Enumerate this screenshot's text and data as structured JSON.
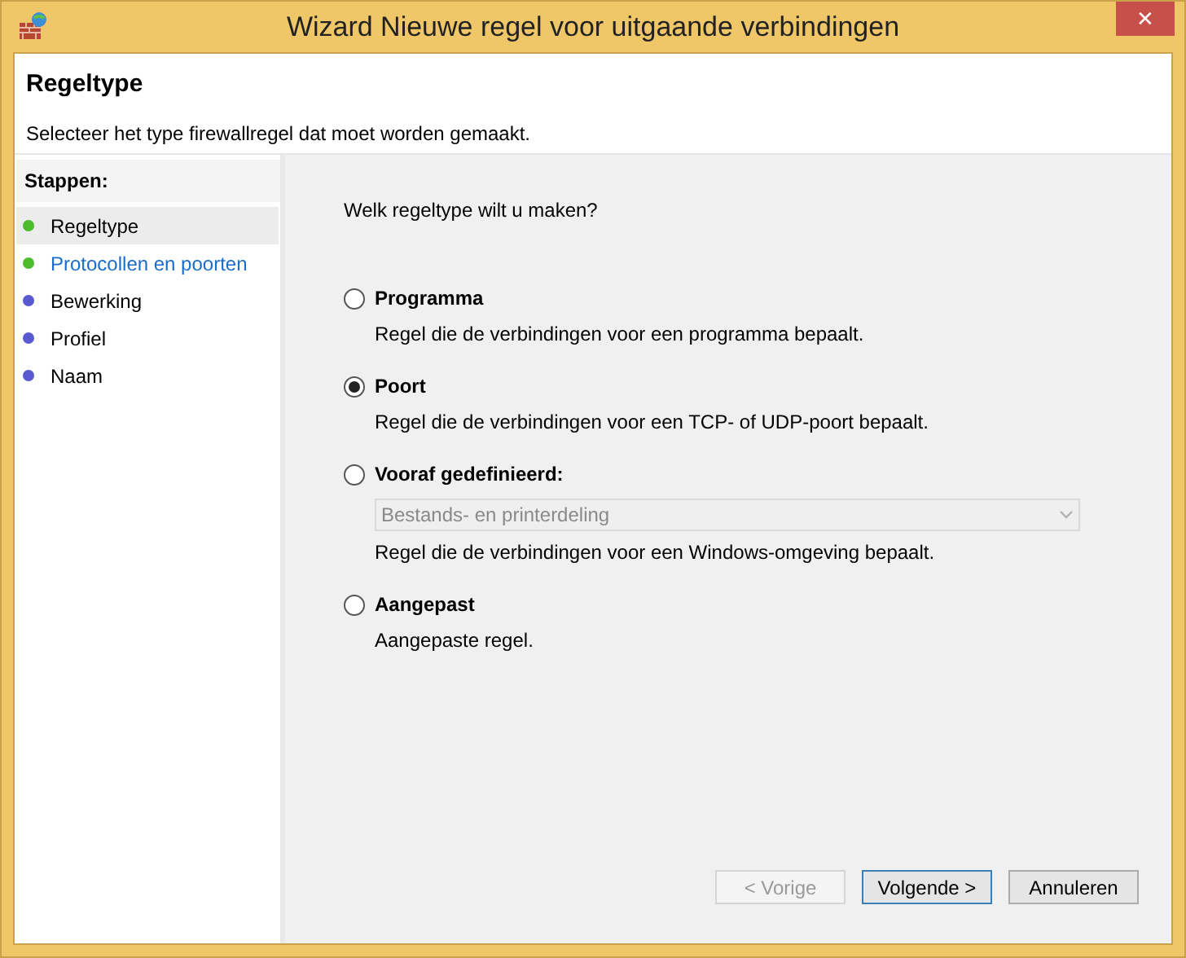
{
  "window": {
    "title": "Wizard Nieuwe regel voor uitgaande verbindingen",
    "close": "✕"
  },
  "header": {
    "title": "Regeltype",
    "subtitle": "Selecteer het type firewallregel dat moet worden gemaakt."
  },
  "steps": {
    "title": "Stappen:",
    "items": [
      {
        "label": "Regeltype",
        "selected": true,
        "link": false,
        "color": "#4cbb2c"
      },
      {
        "label": "Protocollen en poorten",
        "selected": false,
        "link": true,
        "color": "#4cbb2c"
      },
      {
        "label": "Bewerking",
        "selected": false,
        "link": false,
        "color": "#5a5ad0"
      },
      {
        "label": "Profiel",
        "selected": false,
        "link": false,
        "color": "#5a5ad0"
      },
      {
        "label": "Naam",
        "selected": false,
        "link": false,
        "color": "#5a5ad0"
      }
    ]
  },
  "question": "Welk regeltype wilt u maken?",
  "options": [
    {
      "label": "Programma",
      "description": "Regel die de verbindingen voor een programma bepaalt.",
      "selected": false
    },
    {
      "label": "Poort",
      "description": "Regel die de verbindingen voor een TCP- of UDP-poort bepaalt.",
      "selected": true
    },
    {
      "label": "Vooraf gedefinieerd:",
      "dropdown": {
        "value": "Bestands- en printerdeling",
        "disabled": true
      },
      "description": "Regel die de verbindingen voor een Windows-omgeving bepaalt.",
      "selected": false
    },
    {
      "label": "Aangepast",
      "description": "Aangepaste regel.",
      "selected": false
    }
  ],
  "buttons": [
    {
      "label": "< Vorige",
      "disabled": true,
      "default": false
    },
    {
      "label": "Volgende >",
      "disabled": false,
      "default": true
    },
    {
      "label": "Annuleren",
      "disabled": false,
      "default": false
    }
  ]
}
